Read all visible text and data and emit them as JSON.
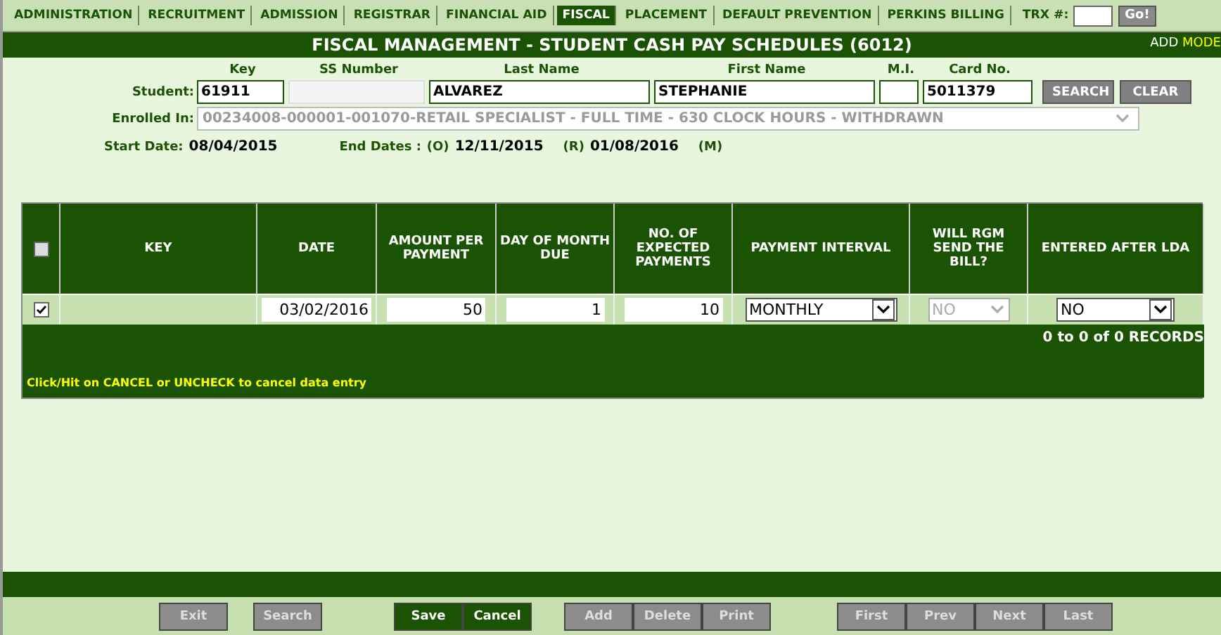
{
  "nav": {
    "tabs": [
      {
        "label": "ADMINISTRATION",
        "selected": false
      },
      {
        "label": "RECRUITMENT",
        "selected": false
      },
      {
        "label": "ADMISSION",
        "selected": false
      },
      {
        "label": "REGISTRAR",
        "selected": false
      },
      {
        "label": "FINANCIAL AID",
        "selected": false
      },
      {
        "label": "FISCAL",
        "selected": true
      },
      {
        "label": "PLACEMENT",
        "selected": false
      },
      {
        "label": "DEFAULT PREVENTION",
        "selected": false
      },
      {
        "label": "PERKINS BILLING",
        "selected": false
      }
    ],
    "trx_label": "TRX #:",
    "go_button": "Go!"
  },
  "title": "FISCAL MANAGEMENT - STUDENT CASH PAY SCHEDULES (6012)",
  "mode": {
    "action": "ADD",
    "word": "MODE"
  },
  "student": {
    "label": "Student:",
    "fields": [
      {
        "heading": "Key",
        "value": "61911"
      },
      {
        "heading": "SS Number",
        "blurred": true
      },
      {
        "heading": "Last Name",
        "value": "ALVAREZ"
      },
      {
        "heading": "First Name",
        "value": "STEPHANIE"
      },
      {
        "heading": "M.I."
      },
      {
        "heading": "Card No.",
        "value": "5011379"
      }
    ],
    "search_button": "SEARCH",
    "clear_button": "CLEAR"
  },
  "enrolled": {
    "label": "Enrolled In:",
    "value": "00234008-000001-001070-RETAIL SPECIALIST - FULL TIME - 630 CLOCK HOURS - WITHDRAWN",
    "disabled": true
  },
  "dates": {
    "start_label": "Start Date:",
    "start": "08/04/2015",
    "end_label": "End Dates :",
    "o_label": "(O)",
    "o": "12/11/2015",
    "r_label": "(R)",
    "r": "01/08/2016",
    "m_label": "(M)"
  },
  "table": {
    "header_checked": false,
    "columns": [
      "KEY",
      "DATE",
      "AMOUNT PER PAYMENT",
      "DAY OF MONTH DUE",
      "NO. OF EXPECTED PAYMENTS",
      "PAYMENT INTERVAL",
      "WILL RGM SEND THE BILL?",
      "ENTERED AFTER LDA"
    ],
    "rows": [
      {
        "checked": true,
        "date": "03/02/2016",
        "amount": "50",
        "day": "1",
        "count": "10",
        "interval": "MONTHLY",
        "rgm": "NO",
        "rgm_disabled": true,
        "lda": "NO"
      }
    ],
    "records": "0 to 0 of 0 RECORDS",
    "hint": "Click/Hit on CANCEL or UNCHECK to cancel data entry"
  },
  "buttons": [
    [
      {
        "label": "Exit",
        "disabled": true
      },
      {
        "label": "Search",
        "disabled": true
      }
    ],
    [
      {
        "label": "Save",
        "disabled": false
      },
      {
        "label": "Cancel",
        "disabled": false
      }
    ],
    [
      {
        "label": "Add",
        "disabled": true
      },
      {
        "label": "Delete",
        "disabled": true
      },
      {
        "label": "Print",
        "disabled": true
      }
    ],
    [
      {
        "label": "First",
        "disabled": true
      },
      {
        "label": "Prev",
        "disabled": true
      },
      {
        "label": "Next",
        "disabled": true
      },
      {
        "label": "Last",
        "disabled": true
      }
    ]
  ]
}
